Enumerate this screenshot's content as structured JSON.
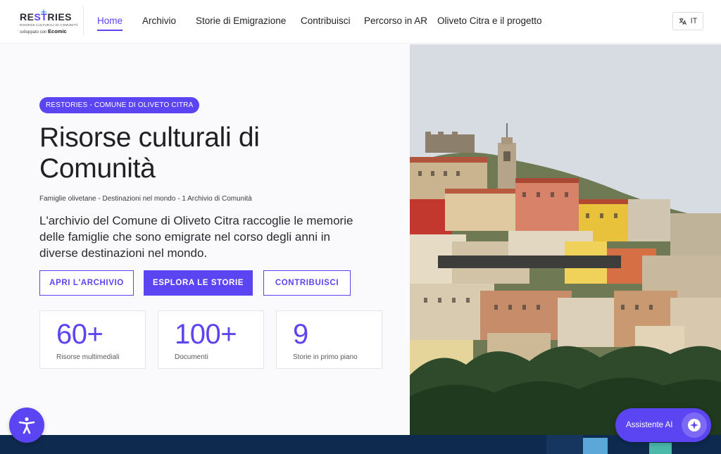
{
  "brand": {
    "logo_prefix": "RE",
    "logo_highlight": "ST",
    "logo_suffix": "RIES",
    "logo_tagline": "RISORSE CULTURALI DI COMUNITÀ",
    "developed_by": "sviluppato con",
    "developer_name": "Ecomic"
  },
  "nav": {
    "items": [
      {
        "label": "Home",
        "active": true
      },
      {
        "label": "Archivio"
      },
      {
        "label": "Storie di Emigrazione"
      },
      {
        "label": "Contribuisci"
      },
      {
        "label": "Percorso in AR"
      },
      {
        "label": "Oliveto Citra e il progetto"
      }
    ],
    "language": "IT",
    "language_icon": "translate-icon"
  },
  "hero": {
    "badge": "RESTORIES - COMUNE DI OLIVETO CITRA",
    "title_line1": "Risorse culturali di",
    "title_line2": "Comunità",
    "subtitle": "Famiglie olivetane - Destinazioni nel mondo - 1 Archivio di Comunità",
    "description": "L'archivio del Comune di Oliveto Citra raccoglie le memorie delle famiglie che sono emigrate nel corso degli anni in diverse destinazioni nel mondo.",
    "buttons": {
      "archive": "APRI L'ARCHIVIO",
      "stories": "ESPLORA LE STORIE",
      "contribute": "CONTRIBUISCI"
    },
    "stats": [
      {
        "value": "60+",
        "label": "Risorse multimediali"
      },
      {
        "value": "100+",
        "label": "Documenti"
      },
      {
        "value": "9",
        "label": "Storie in primo piano"
      }
    ]
  },
  "floating": {
    "accessibility_icon": "accessibility-icon",
    "assistant_label": "Assistente AI",
    "assistant_icon": "sparkle-icon"
  },
  "colors": {
    "accent": "#5b44f2",
    "footer": "#0e2a4e"
  }
}
